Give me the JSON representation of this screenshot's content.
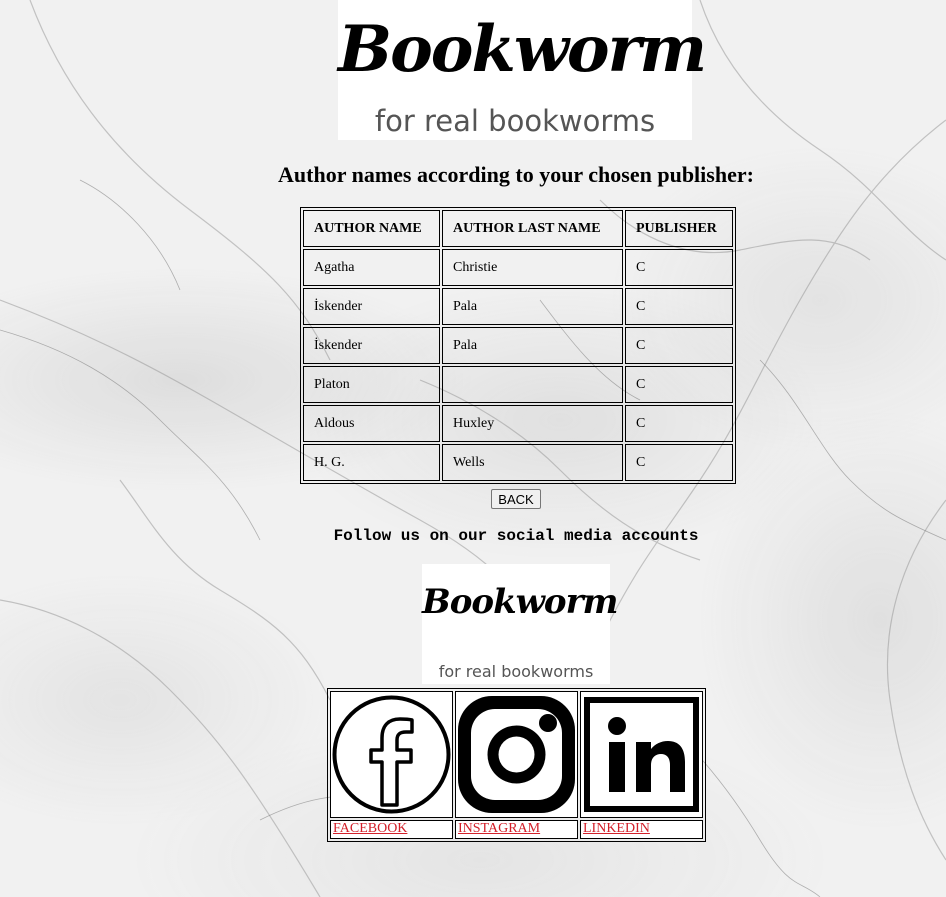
{
  "logo": {
    "title": "Bookworm",
    "tagline": "for real bookworms"
  },
  "heading": "Author names according to your chosen publisher:",
  "table": {
    "headers": [
      "AUTHOR NAME",
      "AUTHOR LAST NAME",
      "PUBLISHER"
    ],
    "rows": [
      [
        "Agatha",
        "Christie",
        "C"
      ],
      [
        "İskender",
        "Pala",
        "C"
      ],
      [
        "İskender",
        "Pala",
        "C"
      ],
      [
        "Platon",
        "",
        "C"
      ],
      [
        "Aldous",
        "Huxley",
        "C"
      ],
      [
        "H. G.",
        "Wells",
        "C"
      ]
    ]
  },
  "back_button": "BACK",
  "follow_text": "Follow us on our social media accounts",
  "social": {
    "links": [
      {
        "label": "FACEBOOK",
        "icon": "facebook-icon"
      },
      {
        "label": "INSTAGRAM",
        "icon": "instagram-icon"
      },
      {
        "label": "LINKEDIN",
        "icon": "linkedin-icon"
      }
    ],
    "link_color": "#d3202a"
  }
}
